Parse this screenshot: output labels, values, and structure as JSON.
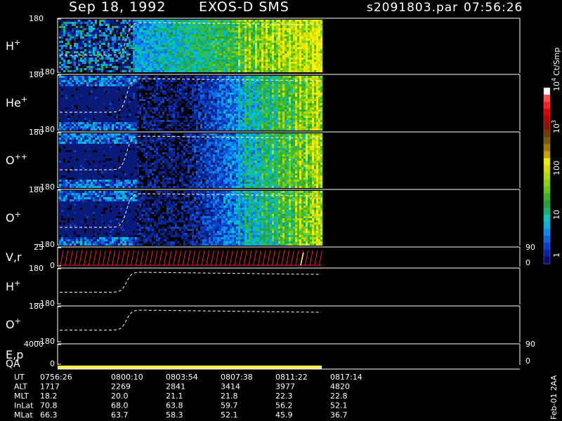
{
  "header": {
    "date": "Sep 18, 1992",
    "instrument": "EXOS-D SMS",
    "file": "s2091803.par",
    "time": "07:56:26"
  },
  "colorbar": {
    "unit": "Ct/Smp",
    "labels": [
      "1",
      "10",
      "100",
      "10",
      "10"
    ],
    "label_sup": [
      "",
      "",
      "",
      "3",
      "4"
    ],
    "colors": [
      "#0a0a80",
      "#0a1eaa",
      "#0a3cd2",
      "#0a64e6",
      "#0a8cf0",
      "#00b4dc",
      "#00c8c8",
      "#14b46e",
      "#1ea03c",
      "#3cb41e",
      "#64c814",
      "#8cd20a",
      "#b4dc0a",
      "#dcdc00",
      "#f0f000",
      "#c8a000",
      "#a07800",
      "#7a5a00",
      "#6e3c00",
      "#8c1400",
      "#b40000",
      "#dc0000",
      "#ff1e1e",
      "#ff5050",
      "#ffffff"
    ]
  },
  "panels": [
    {
      "name": "H+",
      "sup": "+",
      "base": "H",
      "ytop": "180",
      "ybot": "−180"
    },
    {
      "name": "He+",
      "sup": "+",
      "base": "He",
      "ytop": "180",
      "ybot": "−180"
    },
    {
      "name": "O++",
      "sup": "++",
      "base": "O",
      "ytop": "180",
      "ybot": "−180"
    },
    {
      "name": "O+",
      "sup": "+",
      "base": "O",
      "ytop": "180",
      "ybot": "−180"
    },
    {
      "name": "V,r",
      "sup": "",
      "base": "V,r",
      "ytop": "25",
      "ybot": "0",
      "rtop": "90",
      "rbot": "0"
    },
    {
      "name": "H+",
      "sup": "+",
      "base": "H",
      "ytop": "180",
      "ybot": "−180"
    },
    {
      "name": "O+",
      "sup": "+",
      "base": "O",
      "ytop": "180",
      "ybot": "−180"
    },
    {
      "name": "E,p",
      "sup": "",
      "base": "E,p",
      "ytop": "4000",
      "ybot": "0",
      "rtop": "90",
      "rbot": "0"
    }
  ],
  "qa_label": "QA",
  "footer": "Feb-01 2AA",
  "table": {
    "rows": [
      {
        "label": "UT",
        "values": [
          "0756:26",
          "0800:10",
          "0803:54",
          "0807:38",
          "0811:22",
          "0817:14"
        ]
      },
      {
        "label": "ALT",
        "values": [
          "1717",
          "2269",
          "2841",
          "3414",
          "3977",
          "4820"
        ]
      },
      {
        "label": "MLT",
        "values": [
          "18.2",
          "20.0",
          "21.1",
          "21.8",
          "22.3",
          "22.8"
        ]
      },
      {
        "label": "InLat",
        "values": [
          "70.8",
          "68.0",
          "63.8",
          "59.7",
          "56.2",
          "52.1"
        ]
      },
      {
        "label": "MLat",
        "values": [
          "66.3",
          "63.7",
          "58.3",
          "52.1",
          "45.9",
          "36.7"
        ]
      }
    ]
  },
  "chart_data": {
    "type": "heatmap",
    "x_ticks": [
      "0756:26",
      "0800:10",
      "0803:54",
      "0807:38",
      "0811:22",
      "0817:14"
    ],
    "data_end": "0811:22",
    "ylim": [
      -180,
      180
    ],
    "colorbar_scale": "log",
    "colorbar_range": [
      1,
      10000
    ],
    "colorbar_unit": "Ct/Smp",
    "series": [
      {
        "name": "H+"
      },
      {
        "name": "He+"
      },
      {
        "name": "O++"
      },
      {
        "name": "O+"
      },
      {
        "name": "V,r",
        "ylim": [
          0,
          25
        ],
        "right_ylim": [
          0,
          90
        ]
      },
      {
        "name": "H+"
      },
      {
        "name": "O+"
      },
      {
        "name": "E,p",
        "ylim": [
          0,
          4000
        ],
        "right_ylim": [
          0,
          90
        ]
      }
    ]
  }
}
